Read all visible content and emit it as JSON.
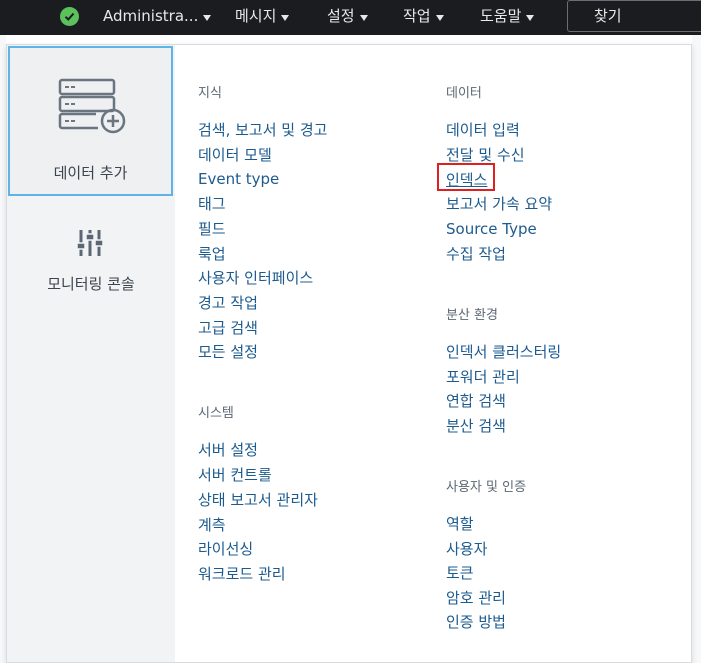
{
  "topbar": {
    "user": "Administra...",
    "menus": [
      "메시지",
      "설정",
      "작업",
      "도움말"
    ],
    "search_label": "찾기",
    "status_color": "#5cc05c"
  },
  "left": {
    "add_data": "데이터 추가",
    "monitoring": "모니터링 콘솔"
  },
  "col1": {
    "knowledge_title": "지식",
    "knowledge_items": [
      "검색, 보고서 및 경고",
      "데이터 모델",
      "Event type",
      "태그",
      "필드",
      "룩업",
      "사용자 인터페이스",
      "경고 작업",
      "고급 검색",
      "모든 설정"
    ],
    "system_title": "시스템",
    "system_items": [
      "서버 설정",
      "서버 컨트롤",
      "상태 보고서 관리자",
      "계측",
      "라이선싱",
      "워크로드 관리"
    ]
  },
  "col2": {
    "data_title": "데이터",
    "data_items": [
      "데이터 입력",
      "전달 및 수신",
      "인덱스",
      "보고서 가속 요약",
      "Source Type",
      "수집 작업"
    ],
    "distributed_title": "분산 환경",
    "distributed_items": [
      "인덱서 클러스터링",
      "포워더 관리",
      "연합 검색",
      "분산 검색"
    ],
    "auth_title": "사용자 및 인증",
    "auth_items": [
      "역할",
      "사용자",
      "토큰",
      "암호 관리",
      "인증 방법"
    ]
  },
  "colors": {
    "link": "#1d5b8f",
    "highlight": "#e0201f",
    "tile_border": "#5fb3e6"
  }
}
